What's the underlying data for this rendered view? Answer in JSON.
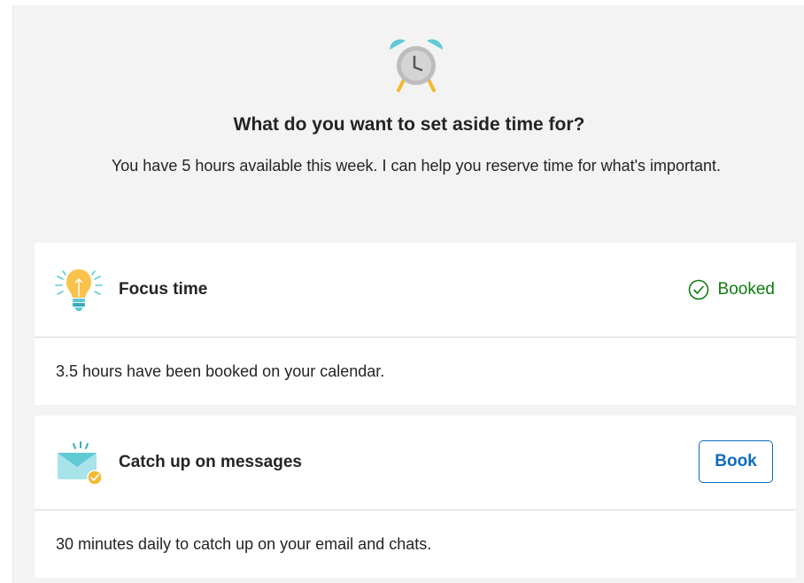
{
  "header": {
    "icon": "alarm-clock-icon",
    "title": "What do you want to set aside time for?",
    "subtitle": "You have 5 hours available this week. I can help you reserve time for what's important."
  },
  "cards": [
    {
      "icon": "lightbulb-icon",
      "title": "Focus time",
      "status": "Booked",
      "status_icon": "checkmark-circle-icon",
      "description": "3.5 hours have been booked on your calendar."
    },
    {
      "icon": "envelope-check-icon",
      "title": "Catch up on messages",
      "action_label": "Book",
      "description": "30 minutes daily to catch up on your email and chats."
    }
  ],
  "colors": {
    "panel_bg": "#f3f3f3",
    "card_bg": "#ffffff",
    "booked_green": "#107c10",
    "accent_blue": "#0f6cbd"
  }
}
